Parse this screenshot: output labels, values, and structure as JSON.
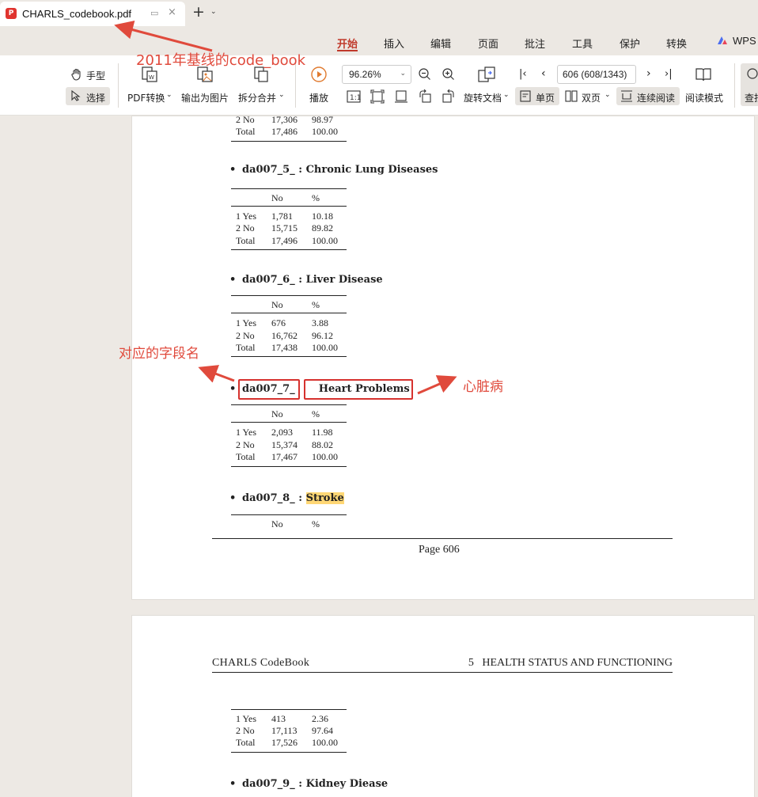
{
  "titlebar": {
    "tab_title": "CHARLS_codebook.pdf",
    "new_tab_icon": "plus-icon"
  },
  "menu": {
    "items": [
      "开始",
      "插入",
      "编辑",
      "页面",
      "批注",
      "工具",
      "保护",
      "转换"
    ],
    "active": "开始",
    "brand": "WPS"
  },
  "toolbar": {
    "hand_label": "手型",
    "select_label": "选择",
    "pdf_convert_label": "PDF转换",
    "export_image_label": "输出为图片",
    "split_merge_label": "拆分合并",
    "play_label": "播放",
    "zoom_value": "96.26%",
    "page_value": "606 (608/1343)",
    "rotate_label": "旋转文档",
    "single_label": "单页",
    "double_label": "双页",
    "continuous_label": "连续阅读",
    "reading_label": "阅读模式",
    "search_label": "查找"
  },
  "doc": {
    "prev_table": {
      "rows": [
        [
          "2 No",
          "17,306",
          "98.97"
        ],
        [
          "Total",
          "17,486",
          "100.00"
        ]
      ]
    },
    "sections": [
      {
        "var": "da007_5_",
        "desc": "Chronic Lung Diseases",
        "header": [
          "No",
          "%"
        ],
        "rows": [
          [
            "1 Yes",
            "1,781",
            "10.18"
          ],
          [
            "2 No",
            "15,715",
            "89.82"
          ],
          [
            "Total",
            "17,496",
            "100.00"
          ]
        ]
      },
      {
        "var": "da007_6_",
        "desc": "Liver Disease",
        "header": [
          "No",
          "%"
        ],
        "rows": [
          [
            "1 Yes",
            "676",
            "3.88"
          ],
          [
            "2 No",
            "16,762",
            "96.12"
          ],
          [
            "Total",
            "17,438",
            "100.00"
          ]
        ]
      },
      {
        "var": "da007_7_",
        "desc": "Heart Problems",
        "header": [
          "No",
          "%"
        ],
        "rows": [
          [
            "1 Yes",
            "2,093",
            "11.98"
          ],
          [
            "2 No",
            "15,374",
            "88.02"
          ],
          [
            "Total",
            "17,467",
            "100.00"
          ]
        ]
      },
      {
        "var": "da007_8_",
        "desc": "Stroke",
        "header": [
          "No",
          "%"
        ]
      }
    ],
    "page_footer": "Page 606",
    "page2_header_left": "CHARLS CodeBook",
    "page2_header_right": "5   HEALTH STATUS AND FUNCTIONING",
    "page2_table": {
      "rows": [
        [
          "1 Yes",
          "413",
          "2.36"
        ],
        [
          "2 No",
          "17,113",
          "97.64"
        ],
        [
          "Total",
          "17,526",
          "100.00"
        ]
      ]
    },
    "next_section": {
      "var": "da007_9_",
      "desc": "Kidney Diease"
    }
  },
  "annotations": {
    "baseline": "2011年基线的code_book",
    "field_name": "对应的字段名",
    "heart": "心脏病"
  },
  "colors": {
    "annotation": "#e04a3c",
    "accent": "#c0392b",
    "highlight": "#ffd775"
  }
}
